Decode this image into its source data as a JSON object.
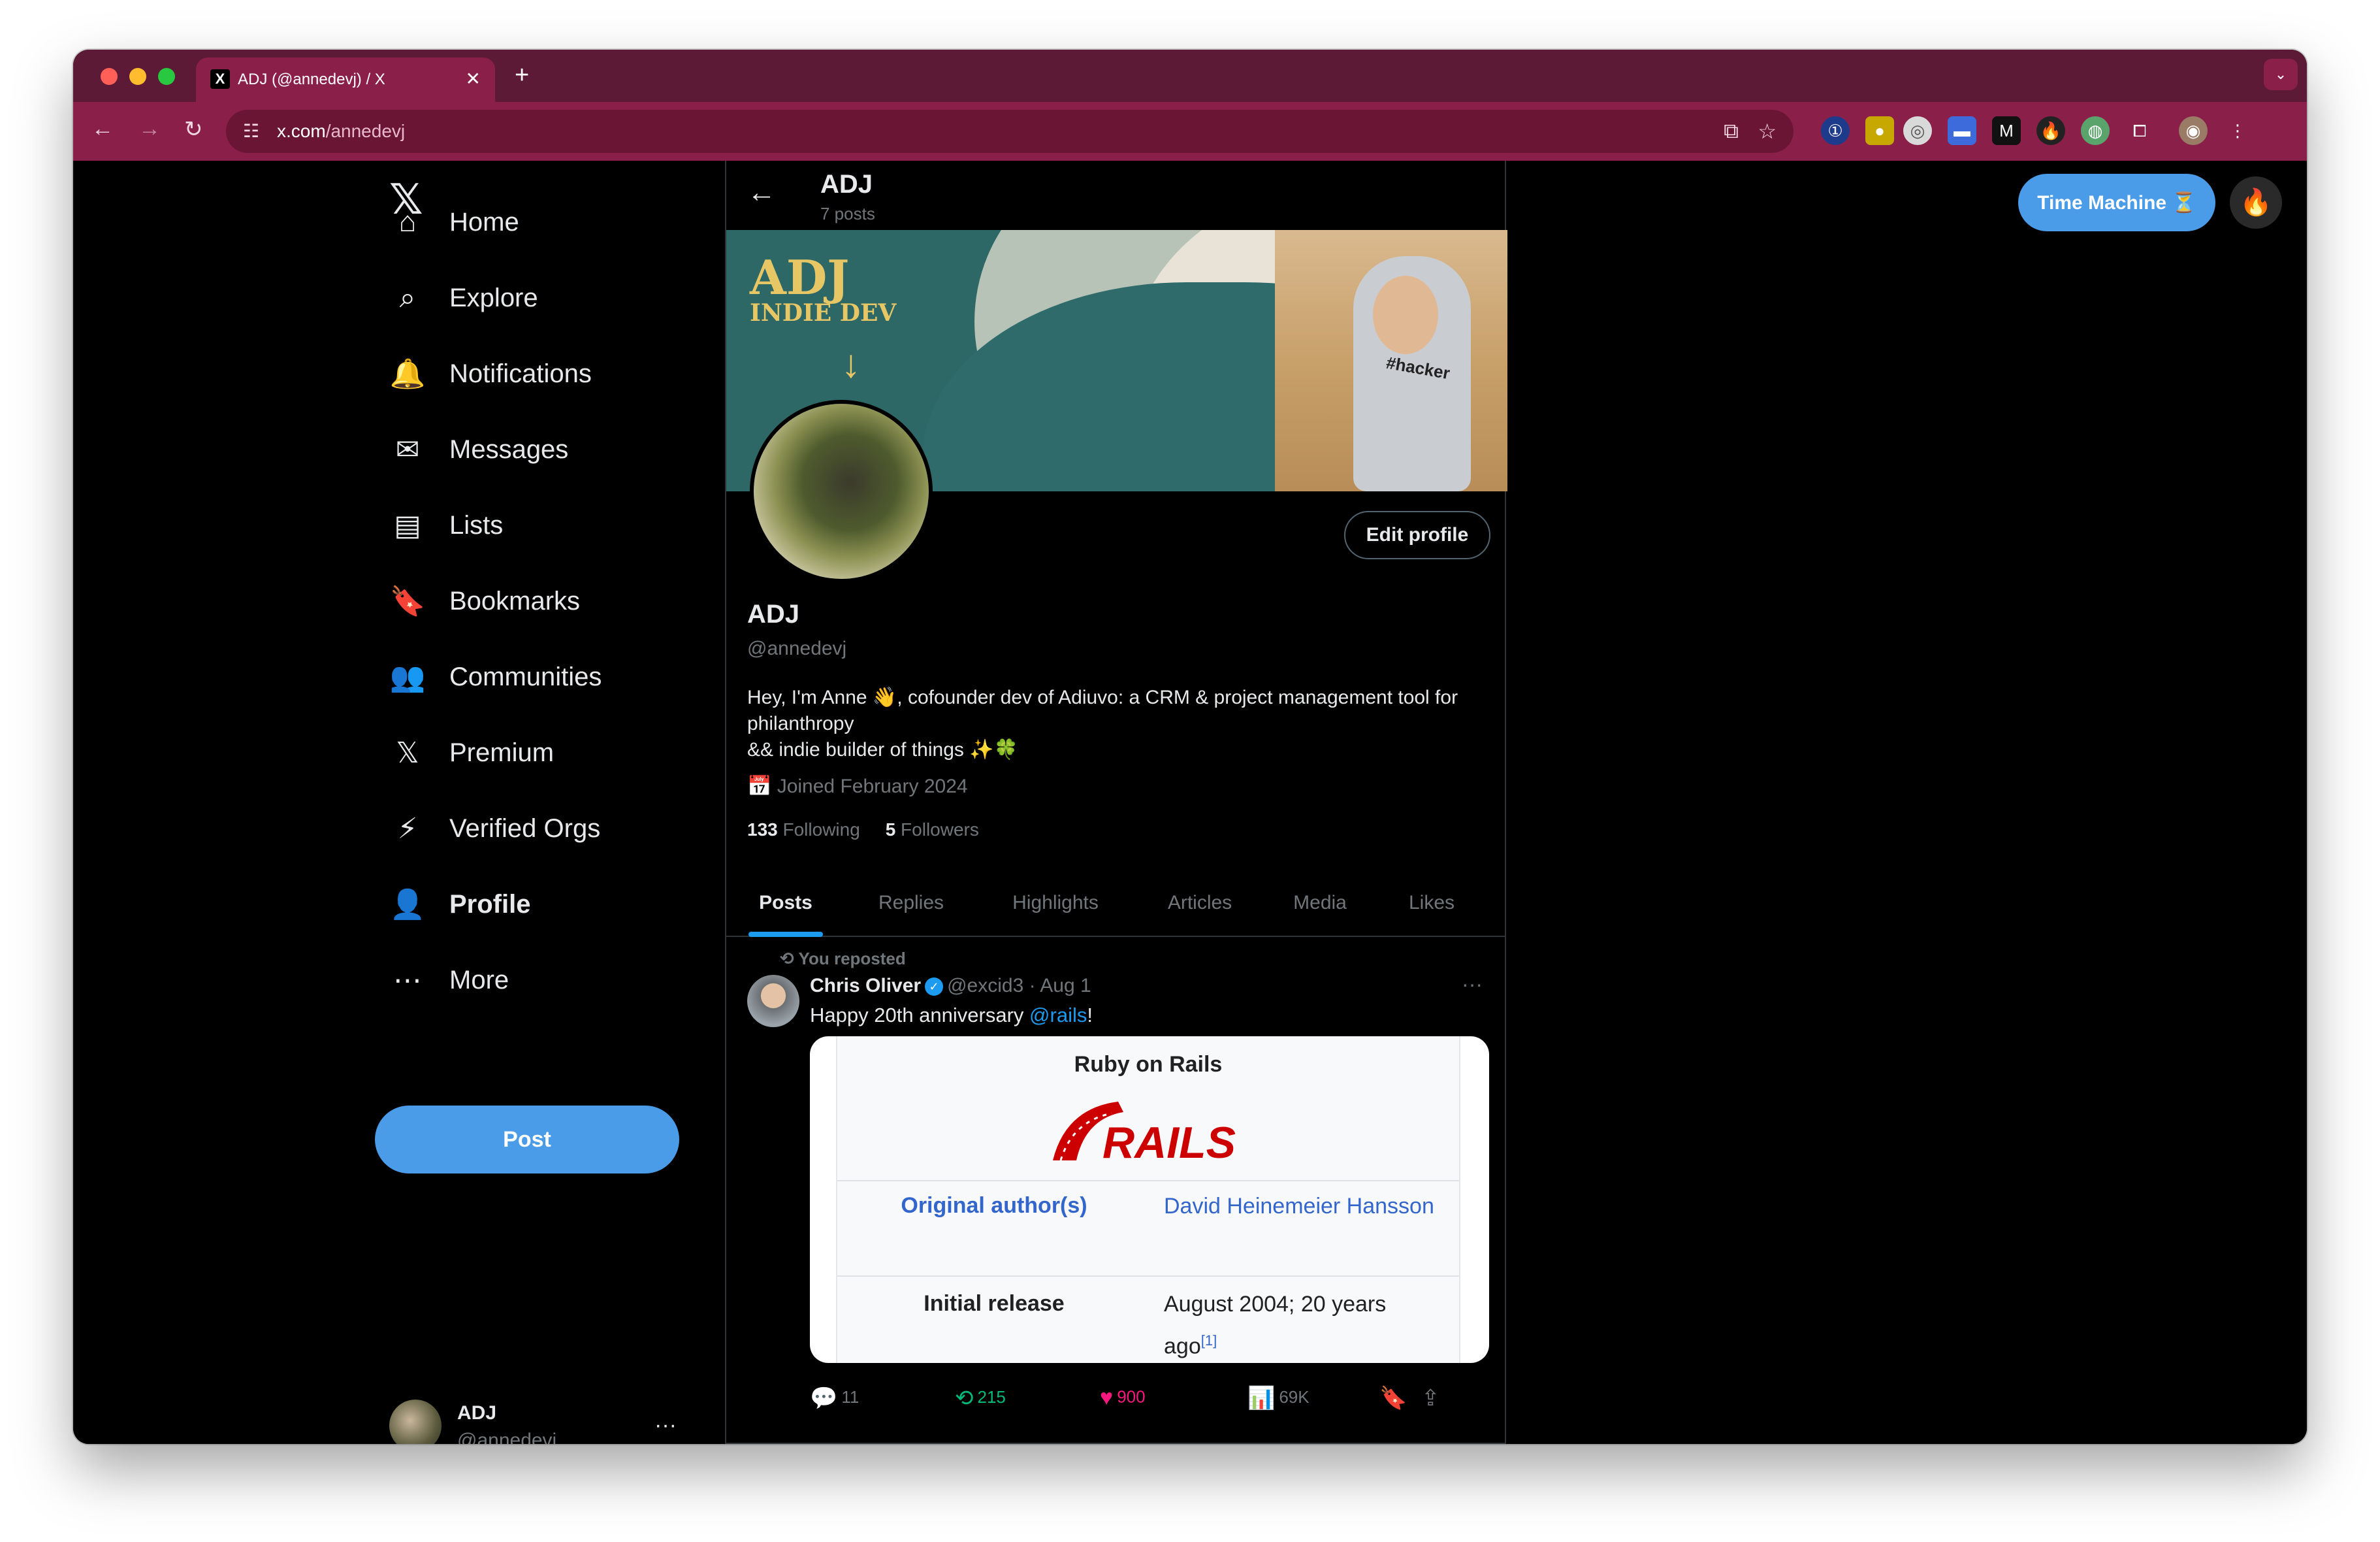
{
  "browser": {
    "tab_title": "ADJ (@annedevj) / X",
    "tab_close": "✕",
    "new_tab": "+",
    "url_host": "x.com",
    "url_path": "/annedevj"
  },
  "sidebar": {
    "logo": "𝕏",
    "items": [
      {
        "label": "Home",
        "icon": "⌂"
      },
      {
        "label": "Explore",
        "icon": "⌕"
      },
      {
        "label": "Notifications",
        "icon": "🔔"
      },
      {
        "label": "Messages",
        "icon": "✉"
      },
      {
        "label": "Lists",
        "icon": "▤"
      },
      {
        "label": "Bookmarks",
        "icon": "🔖"
      },
      {
        "label": "Communities",
        "icon": "👥"
      },
      {
        "label": "Premium",
        "icon": "𝕏"
      },
      {
        "label": "Verified Orgs",
        "icon": "⚡"
      },
      {
        "label": "Profile",
        "icon": "👤"
      },
      {
        "label": "More",
        "icon": "⋯"
      }
    ],
    "post_label": "Post",
    "account": {
      "name": "ADJ",
      "handle": "@annedevj",
      "menu": "···"
    }
  },
  "header": {
    "name": "ADJ",
    "post_count": "7 posts"
  },
  "banner": {
    "line1": "ADJ",
    "line2": "INDIE DEV",
    "shirt": "#hacker"
  },
  "profile": {
    "edit_label": "Edit profile",
    "name": "ADJ",
    "handle": "@annedevj",
    "bio": "Hey, I'm Anne 👋, cofounder dev of Adiuvo: a CRM & project management tool for philanthropy\n&& indie builder of things ✨🍀",
    "joined": "Joined February 2024",
    "following_count": "133",
    "following_label": "Following",
    "followers_count": "5",
    "followers_label": "Followers"
  },
  "tabs": [
    "Posts",
    "Replies",
    "Highlights",
    "Articles",
    "Media",
    "Likes"
  ],
  "tweet": {
    "repost_line": "You reposted",
    "author": "Chris Oliver",
    "handle": "@excid3",
    "date": "· Aug 1",
    "text_before": "Happy 20th anniversary ",
    "mention": "@rails",
    "text_after": "!",
    "card": {
      "title": "Ruby on Rails",
      "logo_text": "RAILS",
      "row1_label": "Original author(s)",
      "row1_value": "David Heinemeier Hansson",
      "row2_label": "Initial release",
      "row2_value": "August 2004; 20 years ago",
      "row2_ref": "[1]"
    },
    "replies": "11",
    "reposts": "215",
    "likes": "900",
    "views": "69K"
  },
  "right": {
    "time_machine_label": "Time Machine ⏳",
    "fire_icon": "🔥"
  },
  "colors": {
    "accent": "#1d9bf0",
    "post_button": "#4a9be8",
    "repost_green": "#00ba7c",
    "like_pink": "#f91880",
    "browser_chrome": "#8a1f4a"
  }
}
